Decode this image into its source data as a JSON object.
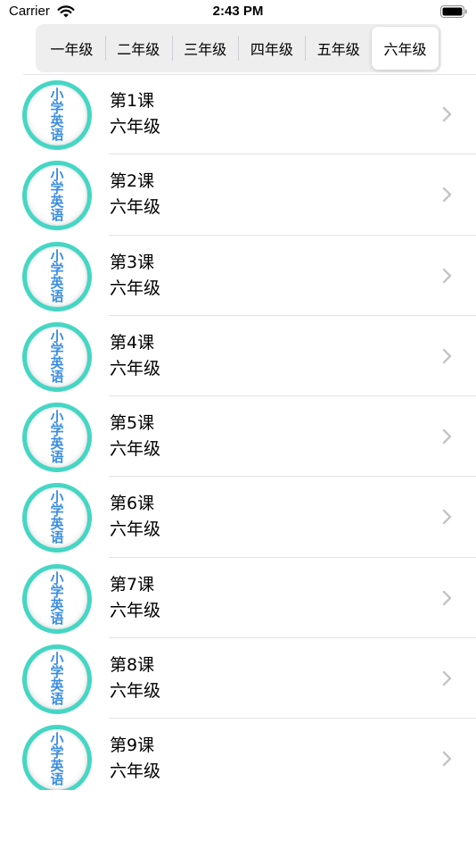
{
  "status_bar": {
    "carrier": "Carrier",
    "time": "2:43 PM",
    "wifi_icon": "wifi-icon",
    "battery_icon": "battery-icon"
  },
  "segments": [
    {
      "label": "一年级",
      "selected": false
    },
    {
      "label": "二年级",
      "selected": false
    },
    {
      "label": "三年级",
      "selected": false
    },
    {
      "label": "四年级",
      "selected": false
    },
    {
      "label": "五年级",
      "selected": false
    },
    {
      "label": "六年级",
      "selected": true
    }
  ],
  "avatar_text": "小学英语",
  "lessons": [
    {
      "title": "第1课",
      "subtitle": "六年级"
    },
    {
      "title": "第2课",
      "subtitle": "六年级"
    },
    {
      "title": "第3课",
      "subtitle": "六年级"
    },
    {
      "title": "第4课",
      "subtitle": "六年级"
    },
    {
      "title": "第5课",
      "subtitle": "六年级"
    },
    {
      "title": "第6课",
      "subtitle": "六年级"
    },
    {
      "title": "第7课",
      "subtitle": "六年级"
    },
    {
      "title": "第8课",
      "subtitle": "六年级"
    },
    {
      "title": "第9课",
      "subtitle": "六年级"
    }
  ],
  "colors": {
    "avatar_ring": "#45d6c4",
    "avatar_text": "#3a8de0",
    "chevron": "#c4c4c7"
  }
}
